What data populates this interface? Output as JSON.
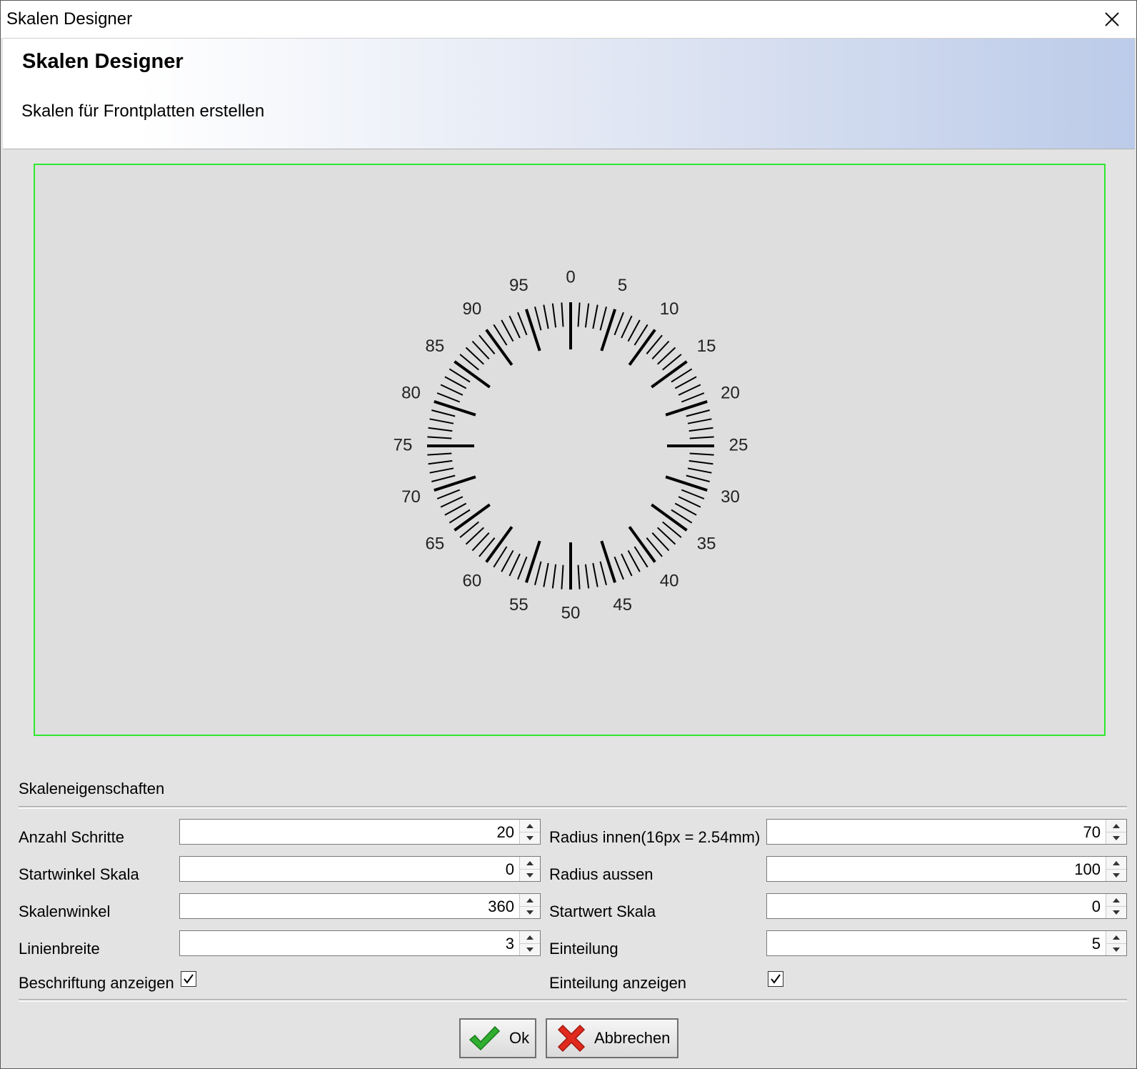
{
  "window": {
    "title": "Skalen Designer"
  },
  "header": {
    "title": "Skalen Designer",
    "subtitle": "Skalen für Frontplatten erstellen"
  },
  "scale": {
    "labels": [
      "0",
      "5",
      "10",
      "15",
      "20",
      "25",
      "30",
      "35",
      "40",
      "45",
      "50",
      "55",
      "60",
      "65",
      "70",
      "75",
      "80",
      "85",
      "90",
      "95"
    ]
  },
  "properties": {
    "section_title": "Skaleneigenschaften",
    "anzahl_schritte": {
      "label": "Anzahl Schritte",
      "value": "20"
    },
    "startwinkel_skala": {
      "label": "Startwinkel Skala",
      "value": "0"
    },
    "skalenwinkel": {
      "label": "Skalenwinkel",
      "value": "360"
    },
    "linienbreite": {
      "label": "Linienbreite",
      "value": "3"
    },
    "beschriftung_anzeigen": {
      "label": "Beschriftung anzeigen",
      "checked": true
    },
    "radius_innen": {
      "label": "Radius innen(16px = 2.54mm)",
      "value": "70"
    },
    "radius_aussen": {
      "label": "Radius aussen",
      "value": "100"
    },
    "startwert_skala": {
      "label": "Startwert Skala",
      "value": "0"
    },
    "einteilung": {
      "label": "Einteilung",
      "value": "5"
    },
    "einteilung_anzeigen": {
      "label": "Einteilung anzeigen",
      "checked": true
    }
  },
  "buttons": {
    "ok": "Ok",
    "cancel": "Abbrechen"
  },
  "icons": {
    "close": "close-icon",
    "ok": "checkmark-icon",
    "cancel": "red-x-icon",
    "spin_up": "arrow-up-icon",
    "spin_down": "arrow-down-icon",
    "check": "checkmark-icon"
  },
  "colors": {
    "preview_border": "#2ee82e",
    "header_gradient_end": "#bccbe9",
    "ok_icon": "#2fae2f",
    "cancel_icon": "#e02a1e"
  }
}
